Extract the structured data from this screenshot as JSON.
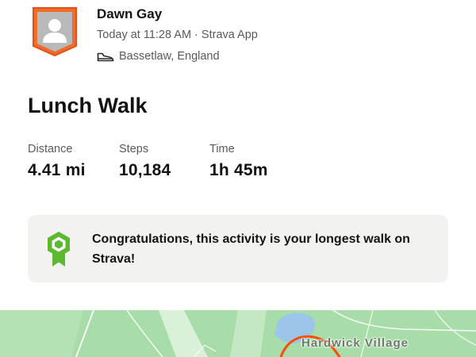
{
  "athlete": {
    "name": "Dawn Gay",
    "meta": "Today at 11:28 AM · Strava App",
    "location": "Bassetlaw, England",
    "location_icon": "shoe-icon",
    "avatar_icon": "avatar-placeholder-icon"
  },
  "activity": {
    "title": "Lunch Walk",
    "stats": {
      "distance": {
        "label": "Distance",
        "value": "4.41 mi"
      },
      "steps": {
        "label": "Steps",
        "value": "10,184"
      },
      "time": {
        "label": "Time",
        "value": "1h 45m"
      }
    }
  },
  "achievement": {
    "icon": "achievement-badge-icon",
    "text": "Congratulations, this activity is your longest walk on Strava!"
  },
  "map": {
    "place_label": "Hardwick Village",
    "route_color": "#fc4c02"
  },
  "colors": {
    "brand_orange": "#fc4c02",
    "badge_green": "#5cb82e",
    "map_green": "#a8dca8"
  }
}
